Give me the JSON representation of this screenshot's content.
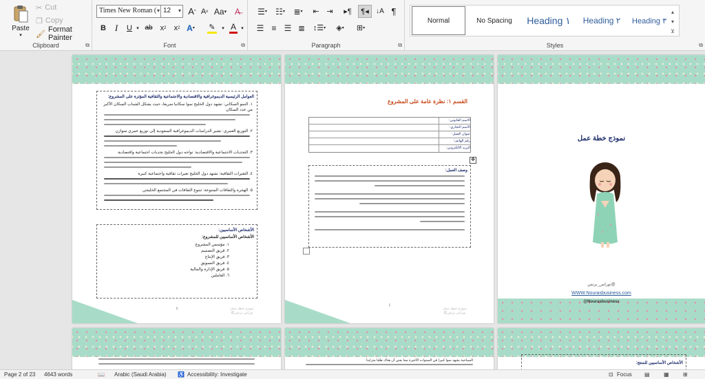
{
  "ribbon": {
    "clipboard": {
      "label": "Clipboard",
      "paste": "Paste",
      "cut": "Cut",
      "copy": "Copy",
      "format_painter": "Format Painter"
    },
    "font": {
      "label": "Font",
      "name": "Times New Roman (",
      "size": "12",
      "grow": "A",
      "shrink": "A",
      "case": "Aa",
      "bold": "B",
      "italic": "I",
      "underline": "U",
      "strike": "ab",
      "subscript": "x",
      "superscript": "x",
      "highlight_color": "#f5e600",
      "font_color": "#d01010"
    },
    "paragraph": {
      "label": "Paragraph"
    },
    "styles": {
      "label": "Styles",
      "items": [
        "Normal",
        "No Spacing",
        "Heading ١",
        "Heading ٢",
        "Heading ٣"
      ]
    }
  },
  "pages": {
    "p1": {
      "heading": "العوامل الرئيسية الديموغرافية والاقتصادية والاجتماعية والثقافية المؤثرة على المشروع:",
      "items": [
        "١.  النمو السكاني: تشهد دول الخليج نموا سكانيا سريعا، حيث يشكل الشباب السكان الأكبر من عدد السكان",
        "٢.  التوزيع العمري: تشير الدراسات الديموغرافية السعودية إلى توزيع عمري متوازن",
        "٣.  التحديات الاجتماعية والاقتصادية: تواجه دول الخليج تحديات اجتماعية واقتصادية",
        "٤.  التغيرات الثقافية: تشهد دول الخليج تغيرات ثقافية واجتماعية كبيرة",
        "٥.  الهجرة والثقافات المتنوعة: تتنوع الثقافات في المجتمع الخليجي"
      ],
      "staff_title": "الأشخاص الأساسيين:",
      "staff_subtitle": "الأشخاص الأساسيين للمشروع:",
      "staff": [
        "١.  مؤسس المشروع",
        "٢.  فريق التصميم",
        "٣.  فريق الإنتاج",
        "٤.  فريق التسويق",
        "٥.  فريق الإدارة والمالية",
        "٦.  العاملين"
      ],
      "number": "٥",
      "footer": [
        "نموذج خطة عمل",
        "@نوراس بزنس"
      ]
    },
    "p2": {
      "heading": "القسم ١: نظرة عامة على المشروع",
      "table_labels": [
        "الاسم القانوني:",
        "الاسم التجاري:",
        "عنوان العمل:",
        "رقم الهاتف:",
        "البريد الالكتروني:"
      ],
      "desc_title": "وصف العمل:",
      "number": "٤",
      "footer": [
        "نموذج خطة عمل",
        "@نوراس بزنس"
      ]
    },
    "p3": {
      "title": "نموذج خطة عمل",
      "author": "@نوراس_بزنس",
      "website": "WWW.Nourasbusiness.com",
      "handle": "@Nourasbusiness"
    },
    "p4": {
      "partial_text": "السياحية بشهد نموا كبيرا في السنوات الأخيرة مما يعني أن هناك طلبا متزايدا"
    },
    "p6": {
      "heading": "الأشخاص الأساسيين للمنتج:"
    }
  },
  "status": {
    "page": "Page 2 of 23",
    "words": "4643 words",
    "language": "Arabic (Saudi Arabia)",
    "accessibility": "Accessibility: Investigate",
    "focus": "Focus"
  }
}
